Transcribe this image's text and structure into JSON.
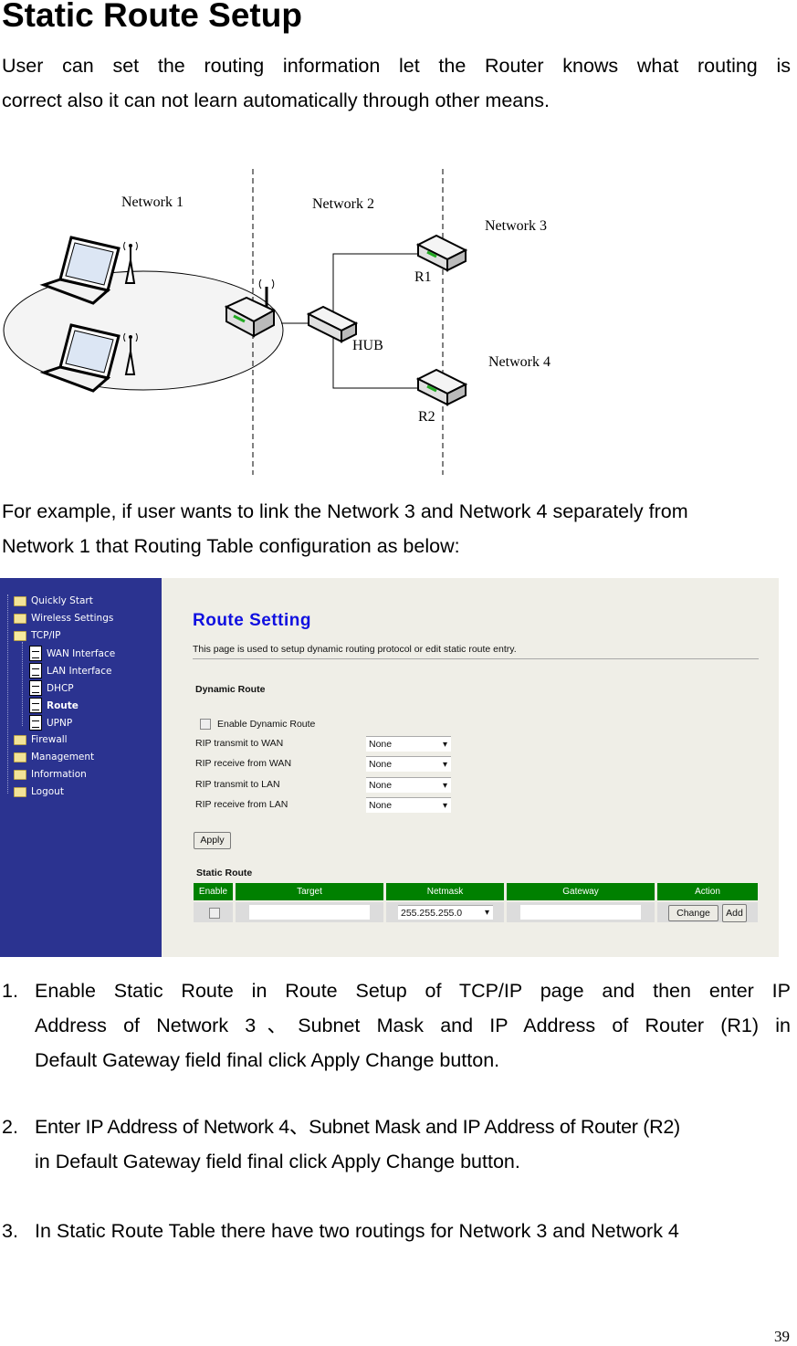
{
  "heading": "Static Route Setup",
  "intro": {
    "line1": "User can set the routing information let the Router knows what routing is",
    "line2": "correct also it can not learn automatically through other means."
  },
  "diagram": {
    "labels": {
      "network1": "Network 1",
      "network2": "Network 2",
      "network3": "Network 3",
      "network4": "Network 4",
      "hub": "HUB",
      "r1": "R1",
      "r2": "R2"
    }
  },
  "example": {
    "line1": "For example, if user wants to link the Network 3 and Network 4 separately from",
    "line2": "Network 1 that Routing Table configuration as below:"
  },
  "router_ui": {
    "sidebar": {
      "items": [
        {
          "label": "Quickly Start",
          "type": "folder"
        },
        {
          "label": "Wireless Settings",
          "type": "folder"
        },
        {
          "label": "TCP/IP",
          "type": "folder-open"
        },
        {
          "label": "WAN Interface",
          "type": "page"
        },
        {
          "label": "LAN Interface",
          "type": "page"
        },
        {
          "label": "DHCP",
          "type": "page"
        },
        {
          "label": "Route",
          "type": "page",
          "active": true
        },
        {
          "label": "UPNP",
          "type": "page"
        },
        {
          "label": "Firewall",
          "type": "folder"
        },
        {
          "label": "Management",
          "type": "folder"
        },
        {
          "label": "Information",
          "type": "folder"
        },
        {
          "label": "Logout",
          "type": "folder"
        }
      ]
    },
    "title": "Route Setting",
    "description": "This page is used to setup dynamic routing protocol or edit static route entry.",
    "dynamic_route": {
      "section_label": "Dynamic Route",
      "enable_label": "Enable Dynamic Route",
      "enable_checked": false,
      "rows": [
        {
          "label": "RIP transmit to WAN",
          "value": "None"
        },
        {
          "label": "RIP receive from WAN",
          "value": "None"
        },
        {
          "label": "RIP transmit to LAN",
          "value": "None"
        },
        {
          "label": "RIP receive from LAN",
          "value": "None"
        }
      ],
      "apply_label": "Apply"
    },
    "static_route": {
      "section_label": "Static Route",
      "columns": [
        "Enable",
        "Target",
        "Netmask",
        "Gateway",
        "Action"
      ],
      "row": {
        "enable_checked": false,
        "target": "",
        "netmask": "255.255.255.0",
        "gateway": "",
        "change_label": "Change",
        "add_label": "Add"
      }
    },
    "colors": {
      "sidebar_bg": "#2b3390",
      "title_color": "#1010e0",
      "table_header": "#008000",
      "content_bg": "#efeee7"
    }
  },
  "steps": [
    {
      "number": "1.",
      "lines": [
        "Enable Static Route in Route Setup of TCP/IP page and then enter IP",
        "Address of Network 3、Subnet Mask and IP Address of Router (R1) in",
        "Default Gateway field final click Apply Change button."
      ]
    },
    {
      "number": "2.",
      "lines": [
        "Enter IP Address of Network 4、Subnet Mask and IP Address of Router (R2)",
        "in Default Gateway field final click Apply Change button."
      ]
    },
    {
      "number": "3.",
      "lines": [
        "In Static Route Table there have two routings for Network 3 and Network 4"
      ]
    }
  ],
  "page_number": "39"
}
